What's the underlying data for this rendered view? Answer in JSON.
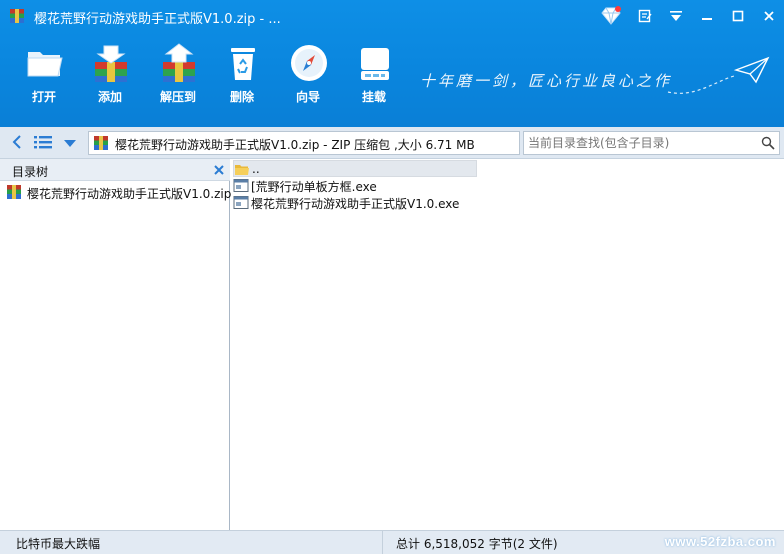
{
  "window": {
    "title": "樱花荒野行动游戏助手正式版V1.0.zip - ..."
  },
  "toolbar": {
    "open_label": "打开",
    "add_label": "添加",
    "extract_label": "解压到",
    "delete_label": "删除",
    "wizard_label": "向导",
    "mount_label": "挂载"
  },
  "slogan": "十年磨一剑，匠心行业良心之作",
  "address": {
    "path": "樱花荒野行动游戏助手正式版V1.0.zip - ZIP 压缩包 ,大小 6.71 MB",
    "search_placeholder": "当前目录查找(包含子目录)"
  },
  "tree": {
    "header": "目录树",
    "items": [
      {
        "label": "樱花荒野行动游戏助手正式版V1.0.zip",
        "icon": "zip-archive-icon"
      }
    ]
  },
  "files": [
    {
      "name": "..",
      "icon": "folder-up-icon",
      "selected": true
    },
    {
      "name": "[荒野行动单板方框.exe",
      "icon": "exe-icon"
    },
    {
      "name": "樱花荒野行动游戏助手正式版V1.0.exe",
      "icon": "exe-icon"
    }
  ],
  "status": {
    "left": "比特币最大跌幅",
    "total": "总计  6,518,052 字节(2 文件)",
    "watermark": "www.52fzba.com"
  },
  "colors": {
    "header_blue": "#0a86de",
    "address_bar": "#dfe8f2",
    "status_bar": "#e2eaf3"
  }
}
